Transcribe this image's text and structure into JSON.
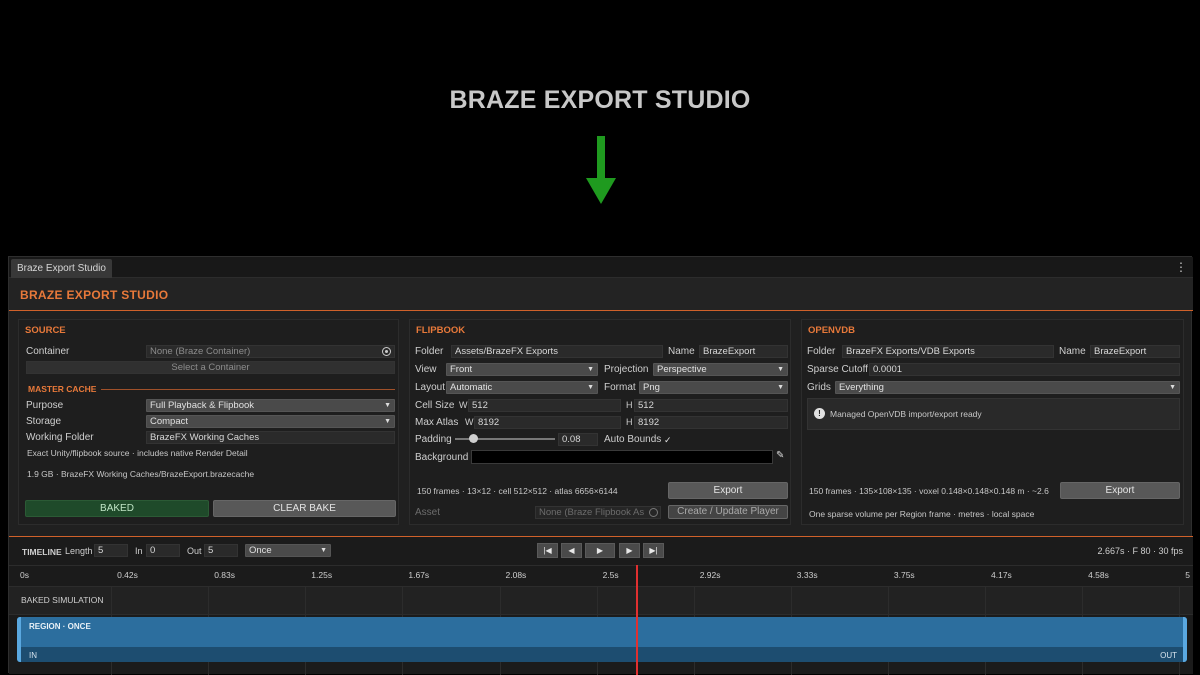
{
  "hero": {
    "title": "BRAZE EXPORT STUDIO",
    "arrow_color": "#1f9a1f"
  },
  "window": {
    "tab_label": "Braze Export Studio",
    "menu_glyph": "⋮",
    "app_title": "BRAZE  EXPORT STUDIO",
    "accent": "#e8793a"
  },
  "source": {
    "header": "SOURCE",
    "container_label": "Container",
    "container_value": "None (Braze Container)",
    "select_button": "Select a Container",
    "master_cache_header": "MASTER CACHE",
    "purpose_label": "Purpose",
    "purpose_value": "Full Playback & Flipbook",
    "storage_label": "Storage",
    "storage_value": "Compact",
    "folder_label": "Working Folder",
    "folder_value": "BrazeFX Working Caches",
    "note": "Exact Unity/flipbook source · includes native Render Detail",
    "cache_info": "1.9 GB · BrazeFX Working Caches/BrazeExport.brazecache",
    "baked_button": "BAKED",
    "clear_button": "CLEAR BAKE"
  },
  "flipbook": {
    "header": "FLIPBOOK",
    "folder_label": "Folder",
    "folder_value": "Assets/BrazeFX Exports",
    "name_label": "Name",
    "name_value": "BrazeExport",
    "view_label": "View",
    "view_value": "Front",
    "projection_label": "Projection",
    "projection_value": "Perspective",
    "layout_label": "Layout",
    "layout_value": "Automatic",
    "format_label": "Format",
    "format_value": "Png",
    "cell_label": "Cell Size",
    "cell_w_label": "W",
    "cell_w": "512",
    "cell_h_label": "H",
    "cell_h": "512",
    "atlas_label": "Max Atlas",
    "atlas_w_label": "W",
    "atlas_w": "8192",
    "atlas_h_label": "H",
    "atlas_h": "8192",
    "padding_label": "Padding",
    "padding_value": "0.08",
    "padding_level": 0.15,
    "autobounds_label": "Auto Bounds",
    "autobounds_check": "✓",
    "background_label": "Background",
    "picker_glyph": "✎",
    "summary": "150 frames · 13×12 · cell 512×512 · atlas 6656×6144",
    "export_button": "Export",
    "asset_label": "Asset",
    "asset_value": "None (Braze Flipbook As",
    "create_button": "Create / Update Player"
  },
  "openvdb": {
    "header": "OPENVDB",
    "folder_label": "Folder",
    "folder_value": "BrazeFX Exports/VDB Exports",
    "name_label": "Name",
    "name_value": "BrazeExport",
    "cutoff_label": "Sparse Cutoff",
    "cutoff_value": "0.0001",
    "grids_label": "Grids",
    "grids_value": "Everything",
    "status_icon": "!",
    "status_text": "Managed OpenVDB import/export ready",
    "summary": "150 frames · 135×108×135 · voxel 0.148×0.148×0.148 m · ~2.6",
    "export_button": "Export",
    "footnote": "One sparse volume per Region frame · metres · local space"
  },
  "timeline": {
    "label": "TIMELINE",
    "length_label": "Length",
    "length_value": "5",
    "in_label": "In",
    "in_value": "0",
    "out_label": "Out",
    "out_value": "5",
    "mode_value": "Once",
    "transport": [
      "|◀",
      "◀",
      "▶",
      "▶",
      "▶|"
    ],
    "status": "2.667s · F 80 · 30 fps",
    "ticks": [
      "0s",
      "0.42s",
      "0.83s",
      "1.25s",
      "1.67s",
      "2.08s",
      "2.5s",
      "2.92s",
      "3.33s",
      "3.75s",
      "4.17s",
      "4.58s",
      "5"
    ],
    "track_label": "BAKED SIMULATION",
    "region_label": "REGION · ONCE",
    "in_marker": "IN",
    "out_marker": "OUT",
    "playhead_time": 2.667,
    "duration": 5,
    "region_color": "#2c6e9e",
    "playhead_color": "#e03030"
  }
}
